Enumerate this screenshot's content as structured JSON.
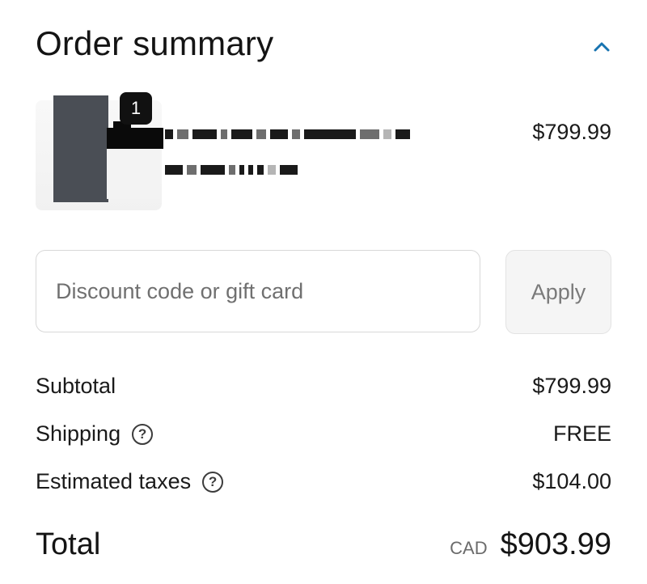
{
  "summary": {
    "title": "Order summary",
    "collapse_icon": "chevron-up-icon",
    "accent_color": "#1773b0"
  },
  "product": {
    "quantity": "1",
    "price": "$799.99"
  },
  "discount": {
    "placeholder": "Discount code or gift card",
    "value": "",
    "apply_label": "Apply"
  },
  "totals": {
    "subtotal_label": "Subtotal",
    "subtotal_value": "$799.99",
    "shipping_label": "Shipping",
    "shipping_value": "FREE",
    "taxes_label": "Estimated taxes",
    "taxes_value": "$104.00",
    "help_icon": "question-circle-icon",
    "total_label": "Total",
    "currency": "CAD",
    "total_value": "$903.99"
  }
}
